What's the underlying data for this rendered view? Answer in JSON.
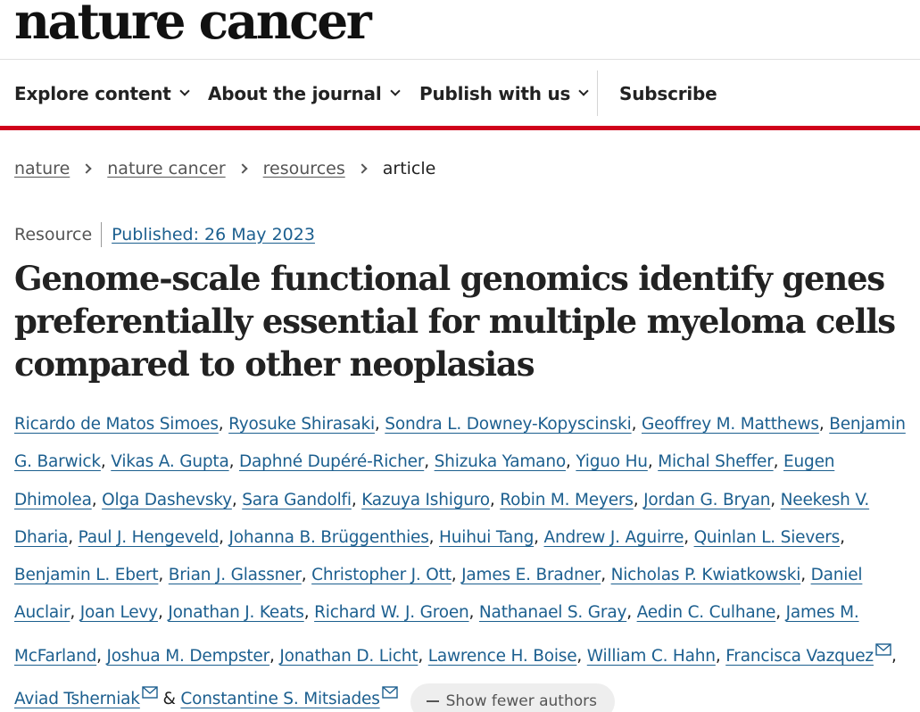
{
  "journal": {
    "logo_text": "nature cancer"
  },
  "nav": {
    "items": [
      {
        "label": "Explore content"
      },
      {
        "label": "About the journal"
      },
      {
        "label": "Publish with us"
      }
    ],
    "subscribe_label": "Subscribe"
  },
  "breadcrumb": [
    {
      "label": "nature"
    },
    {
      "label": "nature cancer"
    },
    {
      "label": "resources"
    },
    {
      "label": "article"
    }
  ],
  "article": {
    "type": "Resource",
    "published": "Published: 26 May 2023",
    "title": "Genome-scale functional genomics identify genes preferentially essential for multiple myeloma cells compared to other neoplasias",
    "authors": [
      "Ricardo de Matos Simoes",
      "Ryosuke Shirasaki",
      "Sondra L. Downey-Kopyscinski",
      "Geoffrey M. Matthews",
      "Benjamin G. Barwick",
      "Vikas A. Gupta",
      "Daphné Dupéré-Richer",
      "Shizuka Yamano",
      "Yiguo Hu",
      "Michal Sheffer",
      "Eugen Dhimolea",
      "Olga Dashevsky",
      "Sara Gandolfi",
      "Kazuya Ishiguro",
      "Robin M. Meyers",
      "Jordan G. Bryan",
      "Neekesh V. Dharia",
      "Paul J. Hengeveld",
      "Johanna B. Brüggenthies",
      "Huihui Tang",
      "Andrew J. Aguirre",
      "Quinlan L. Sievers",
      "Benjamin L. Ebert",
      "Brian J. Glassner",
      "Christopher J. Ott",
      "James E. Bradner",
      "Nicholas P. Kwiatkowski",
      "Daniel Auclair",
      "Joan Levy",
      "Jonathan J. Keats",
      "Richard W. J. Groen",
      "Nathanael S. Gray",
      "Aedin C. Culhane",
      "James M. McFarland",
      "Joshua M. Dempster",
      "Jonathan D. Licht",
      "Lawrence H. Boise",
      "William C. Hahn",
      "Francisca Vazquez",
      "Aviad Tsherniak",
      "Constantine S. Mitsiades"
    ],
    "corresponding_authors": [
      "Francisca Vazquez",
      "Aviad Tsherniak",
      "Constantine S. Mitsiades"
    ],
    "separator": ", ",
    "last_separator": " & ",
    "show_fewer_label": "Show fewer authors"
  },
  "icons": {
    "nav_dropdown": "chevron-down-icon",
    "breadcrumb_sep": "chevron-right-icon",
    "contact": "mail-icon",
    "collapse": "minus-icon"
  },
  "colors": {
    "accent_red": "#d0021b",
    "link_blue": "#1c5f8f",
    "text": "#222222",
    "muted": "#555555",
    "pill_bg": "#eeeeee"
  }
}
